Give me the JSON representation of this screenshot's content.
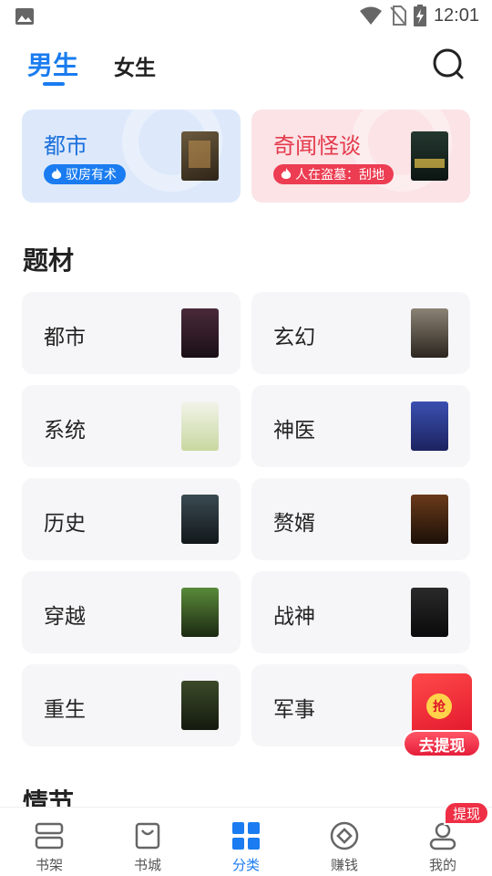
{
  "status_bar": {
    "time": "12:01"
  },
  "header": {
    "tabs": [
      {
        "label": "男生",
        "active": true
      },
      {
        "label": "女生",
        "active": false
      }
    ]
  },
  "featured": [
    {
      "title": "都市",
      "badge": "驭房有术",
      "color": "#1a6fdc"
    },
    {
      "title": "奇闻怪谈",
      "badge": "人在盗墓：刮地",
      "color": "#e43b4c"
    }
  ],
  "sections": {
    "themes_title": "题材",
    "plot_title": "情节"
  },
  "categories": [
    {
      "label": "都市"
    },
    {
      "label": "玄幻"
    },
    {
      "label": "系统"
    },
    {
      "label": "神医"
    },
    {
      "label": "历史"
    },
    {
      "label": "赘婿"
    },
    {
      "label": "穿越"
    },
    {
      "label": "战神"
    },
    {
      "label": "重生"
    },
    {
      "label": "军事"
    }
  ],
  "redpacket": {
    "coin": "抢",
    "label": "去提现"
  },
  "bottom_nav": {
    "items": [
      {
        "label": "书架",
        "icon": "bookshelf-icon"
      },
      {
        "label": "书城",
        "icon": "store-bag-icon"
      },
      {
        "label": "分类",
        "icon": "category-grid-icon",
        "active": true
      },
      {
        "label": "赚钱",
        "icon": "coin-icon"
      },
      {
        "label": "我的",
        "icon": "profile-icon"
      }
    ],
    "badge": "提现"
  },
  "colors": {
    "accent": "#1a7cf0",
    "red": "#ec3d52",
    "card_bg": "#f6f6f8"
  }
}
